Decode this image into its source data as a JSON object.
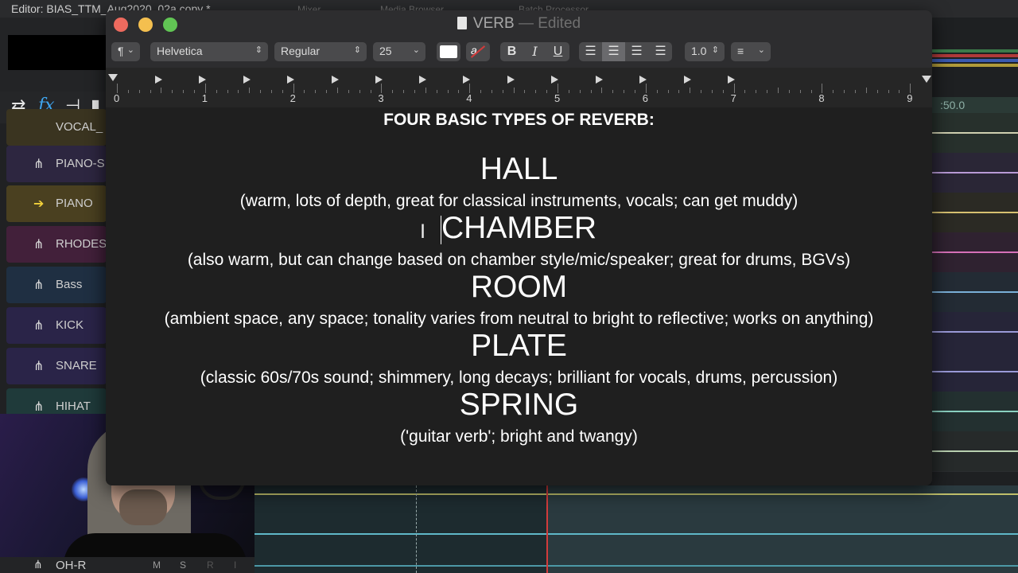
{
  "daw": {
    "editor_title": "Editor: BIAS_TTM_Aug2020_02a copy *",
    "menu_items": [
      "Mixer",
      "Media Browser",
      "Batch Processor"
    ],
    "time_readout": ":50.0",
    "tracks": [
      {
        "name": "VOCAL_",
        "color": "#3a3420"
      },
      {
        "name": "PIANO-S",
        "color": "#2d2640"
      },
      {
        "name": "PIANO",
        "color": "#4a4020"
      },
      {
        "name": "RHODES",
        "color": "#42203a"
      },
      {
        "name": "Bass",
        "color": "#1f2f42"
      },
      {
        "name": "KICK",
        "color": "#2a2448"
      },
      {
        "name": "SNARE",
        "color": "#2a2448"
      },
      {
        "name": "HIHAT",
        "color": "#1f3a3a"
      }
    ],
    "bottom_track": {
      "name": "OH-R",
      "buttons": [
        "M",
        "S",
        "R",
        "I"
      ]
    }
  },
  "window": {
    "title": "VERB",
    "state": "— Edited",
    "toolbar": {
      "paragraph_style": "¶",
      "font_family": "Helvetica",
      "font_style": "Regular",
      "font_size": "25",
      "bold": "B",
      "italic": "I",
      "underline": "U",
      "line_spacing": "1.0",
      "list_icon": "≡",
      "text_color_icon": "a"
    },
    "ruler_numbers": [
      "0",
      "1",
      "2",
      "3",
      "4",
      "5",
      "6",
      "7",
      "8",
      "9"
    ]
  },
  "document": {
    "heading": "FOUR BASIC TYPES OF REVERB:",
    "types": [
      {
        "name": "HALL",
        "description": "(warm, lots of depth, great for classical instruments, vocals; can get muddy)"
      },
      {
        "name": "CHAMBER",
        "description": "(also warm, but can change based on chamber style/mic/speaker; great for drums, BGVs)"
      },
      {
        "name": "ROOM",
        "description": "(ambient space, any space; tonality varies from neutral to bright to reflective; works on anything)"
      },
      {
        "name": "PLATE",
        "description": "(classic 60s/70s sound; shimmery, long decays; brilliant for vocals, drums, percussion)"
      },
      {
        "name": "SPRING",
        "description": "('guitar verb'; bright and twangy)"
      }
    ]
  }
}
